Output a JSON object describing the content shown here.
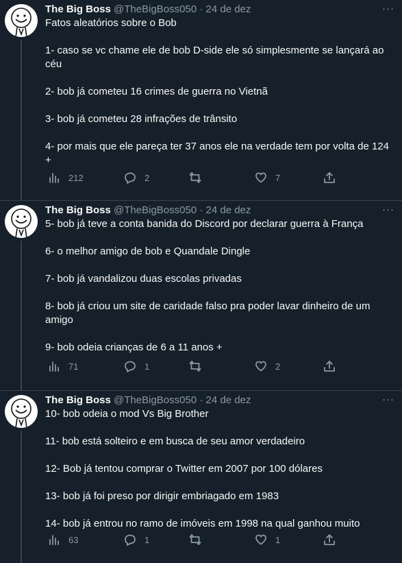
{
  "author": {
    "name": "The Big Boss",
    "handle": "@TheBigBoss050",
    "separator": "·"
  },
  "tweets": [
    {
      "date": "24 de dez",
      "lines": [
        "Fatos aleatórios sobre o Bob",
        "1- caso se vc chame ele de bob D-side ele só simplesmente se lançará ao céu",
        "2- bob já cometeu 16 crimes de guerra no Vietnã",
        "3- bob já cometeu 28 infrações de trânsito",
        "4- por mais que ele pareça ter 37 anos ele na verdade tem por volta de 124 +"
      ],
      "views": "212",
      "replies": "2",
      "retweets": "",
      "likes": "7"
    },
    {
      "date": "24 de dez",
      "lines": [
        "5- bob já teve a conta banida do Discord por declarar guerra à França",
        "6- o melhor amigo de bob e Quandale Dingle",
        "7- bob já vandalizou duas escolas privadas",
        "8- bob já criou um site de caridade falso pra poder lavar dinheiro de um amigo",
        "9- bob odeia crianças de 6 a 11 anos +"
      ],
      "views": "71",
      "replies": "1",
      "retweets": "",
      "likes": "2"
    },
    {
      "date": "24 de dez",
      "lines": [
        "10- bob odeia o mod Vs Big Brother",
        "11- bob está solteiro e em busca de seu amor verdadeiro",
        "12- Bob já tentou comprar o Twitter em 2007 por 100 dólares",
        "13- bob já foi preso por dirigir embriagado em 1983",
        "14- bob já entrou no ramo de imóveis em 1998 na qual ganhou muito"
      ],
      "views": "63",
      "replies": "1",
      "retweets": "",
      "likes": "1"
    }
  ],
  "colors": {
    "background": "#15202b",
    "text": "#f7f9f9",
    "muted": "#8b98a5",
    "border": "#38444d"
  },
  "icons": [
    "avatar-smiley",
    "more-icon",
    "views-icon",
    "reply-icon",
    "retweet-icon",
    "like-icon",
    "share-icon"
  ]
}
